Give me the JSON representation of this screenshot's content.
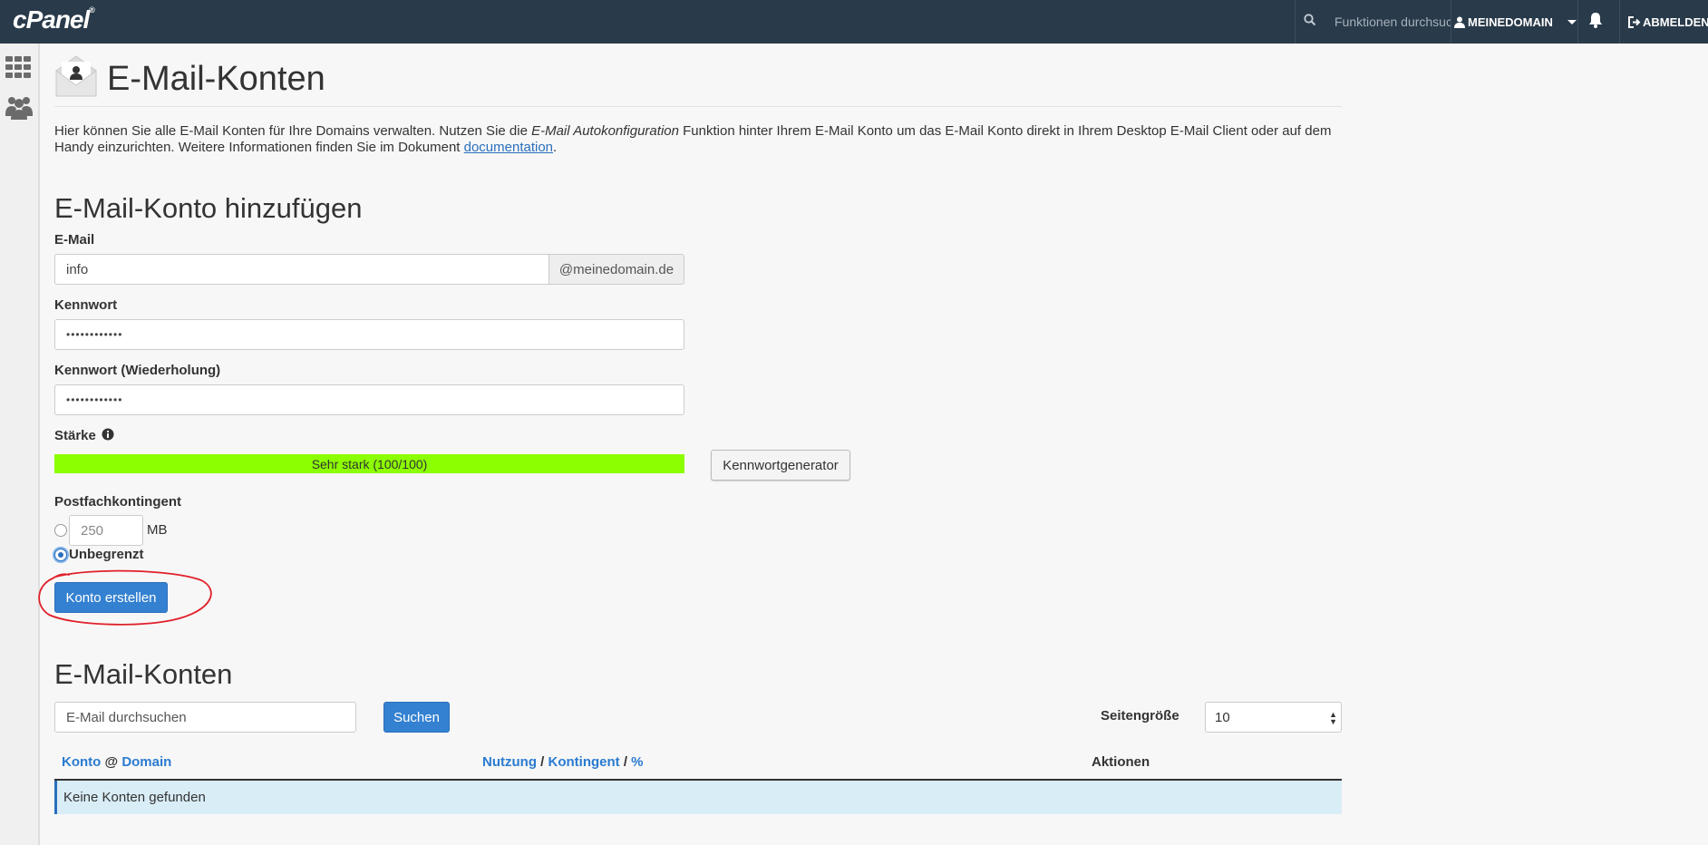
{
  "topbar": {
    "logo": "cPanel",
    "search_placeholder": "Funktionen durchsuc",
    "user": "MEINEDOMAIN",
    "logout": "ABMELDEN"
  },
  "page": {
    "title": "E-Mail-Konten",
    "intro_part1": "Hier können Sie alle E-Mail Konten für Ihre Domains verwalten. Nutzen Sie die ",
    "intro_em": "E-Mail Autokonfiguration",
    "intro_part2": " Funktion hinter Ihrem E-Mail Konto um das E-Mail Konto direkt in Ihrem Desktop E-Mail Client oder auf dem Handy einzurichten. Weitere Informationen finden Sie im Dokument ",
    "intro_link": "documentation",
    "intro_end": "."
  },
  "add_form": {
    "heading": "E-Mail-Konto hinzufügen",
    "email_label": "E-Mail",
    "email_value": "info",
    "email_domain": "@meinedomain.de",
    "password_label": "Kennwort",
    "password_value": "••••••••••••",
    "password_repeat_label": "Kennwort (Wiederholung)",
    "password_repeat_value": "••••••••••••",
    "strength_label": "Stärke",
    "strength_text": "Sehr stark (100/100)",
    "strength_percent": 100,
    "generator_button": "Kennwortgenerator",
    "quota_label": "Postfachkontingent",
    "quota_value": "250",
    "quota_unit": "MB",
    "unlimited_label": "Unbegrenzt",
    "unlimited_selected": true,
    "submit_button": "Konto erstellen"
  },
  "accounts": {
    "heading": "E-Mail-Konten",
    "search_placeholder": "E-Mail durchsuchen",
    "search_button": "Suchen",
    "page_size_label": "Seitengröße",
    "page_size_value": "10",
    "col_account": "Konto",
    "col_at": "@",
    "col_domain": "Domain",
    "col_usage": "Nutzung",
    "col_slash1": "/",
    "col_quota": "Kontingent",
    "col_slash2": "/",
    "col_percent": "%",
    "col_actions": "Aktionen",
    "empty_message": "Keine Konten gefunden"
  },
  "colors": {
    "topbar": "#293a4a",
    "primary": "#3481d1",
    "strength": "#8cff00",
    "annotation": "#e0202a",
    "empty_row": "#d9edf7"
  }
}
